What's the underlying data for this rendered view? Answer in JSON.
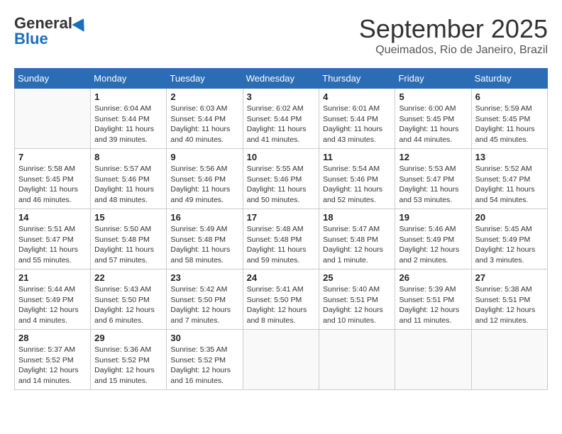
{
  "header": {
    "logo_general": "General",
    "logo_blue": "Blue",
    "month_title": "September 2025",
    "location": "Queimados, Rio de Janeiro, Brazil"
  },
  "columns": [
    "Sunday",
    "Monday",
    "Tuesday",
    "Wednesday",
    "Thursday",
    "Friday",
    "Saturday"
  ],
  "weeks": [
    [
      {
        "day": "",
        "empty": true
      },
      {
        "day": "1",
        "sunrise": "Sunrise: 6:04 AM",
        "sunset": "Sunset: 5:44 PM",
        "daylight": "Daylight: 11 hours and 39 minutes."
      },
      {
        "day": "2",
        "sunrise": "Sunrise: 6:03 AM",
        "sunset": "Sunset: 5:44 PM",
        "daylight": "Daylight: 11 hours and 40 minutes."
      },
      {
        "day": "3",
        "sunrise": "Sunrise: 6:02 AM",
        "sunset": "Sunset: 5:44 PM",
        "daylight": "Daylight: 11 hours and 41 minutes."
      },
      {
        "day": "4",
        "sunrise": "Sunrise: 6:01 AM",
        "sunset": "Sunset: 5:44 PM",
        "daylight": "Daylight: 11 hours and 43 minutes."
      },
      {
        "day": "5",
        "sunrise": "Sunrise: 6:00 AM",
        "sunset": "Sunset: 5:45 PM",
        "daylight": "Daylight: 11 hours and 44 minutes."
      },
      {
        "day": "6",
        "sunrise": "Sunrise: 5:59 AM",
        "sunset": "Sunset: 5:45 PM",
        "daylight": "Daylight: 11 hours and 45 minutes."
      }
    ],
    [
      {
        "day": "7",
        "sunrise": "Sunrise: 5:58 AM",
        "sunset": "Sunset: 5:45 PM",
        "daylight": "Daylight: 11 hours and 46 minutes."
      },
      {
        "day": "8",
        "sunrise": "Sunrise: 5:57 AM",
        "sunset": "Sunset: 5:46 PM",
        "daylight": "Daylight: 11 hours and 48 minutes."
      },
      {
        "day": "9",
        "sunrise": "Sunrise: 5:56 AM",
        "sunset": "Sunset: 5:46 PM",
        "daylight": "Daylight: 11 hours and 49 minutes."
      },
      {
        "day": "10",
        "sunrise": "Sunrise: 5:55 AM",
        "sunset": "Sunset: 5:46 PM",
        "daylight": "Daylight: 11 hours and 50 minutes."
      },
      {
        "day": "11",
        "sunrise": "Sunrise: 5:54 AM",
        "sunset": "Sunset: 5:46 PM",
        "daylight": "Daylight: 11 hours and 52 minutes."
      },
      {
        "day": "12",
        "sunrise": "Sunrise: 5:53 AM",
        "sunset": "Sunset: 5:47 PM",
        "daylight": "Daylight: 11 hours and 53 minutes."
      },
      {
        "day": "13",
        "sunrise": "Sunrise: 5:52 AM",
        "sunset": "Sunset: 5:47 PM",
        "daylight": "Daylight: 11 hours and 54 minutes."
      }
    ],
    [
      {
        "day": "14",
        "sunrise": "Sunrise: 5:51 AM",
        "sunset": "Sunset: 5:47 PM",
        "daylight": "Daylight: 11 hours and 55 minutes."
      },
      {
        "day": "15",
        "sunrise": "Sunrise: 5:50 AM",
        "sunset": "Sunset: 5:48 PM",
        "daylight": "Daylight: 11 hours and 57 minutes."
      },
      {
        "day": "16",
        "sunrise": "Sunrise: 5:49 AM",
        "sunset": "Sunset: 5:48 PM",
        "daylight": "Daylight: 11 hours and 58 minutes."
      },
      {
        "day": "17",
        "sunrise": "Sunrise: 5:48 AM",
        "sunset": "Sunset: 5:48 PM",
        "daylight": "Daylight: 11 hours and 59 minutes."
      },
      {
        "day": "18",
        "sunrise": "Sunrise: 5:47 AM",
        "sunset": "Sunset: 5:48 PM",
        "daylight": "Daylight: 12 hours and 1 minute."
      },
      {
        "day": "19",
        "sunrise": "Sunrise: 5:46 AM",
        "sunset": "Sunset: 5:49 PM",
        "daylight": "Daylight: 12 hours and 2 minutes."
      },
      {
        "day": "20",
        "sunrise": "Sunrise: 5:45 AM",
        "sunset": "Sunset: 5:49 PM",
        "daylight": "Daylight: 12 hours and 3 minutes."
      }
    ],
    [
      {
        "day": "21",
        "sunrise": "Sunrise: 5:44 AM",
        "sunset": "Sunset: 5:49 PM",
        "daylight": "Daylight: 12 hours and 4 minutes."
      },
      {
        "day": "22",
        "sunrise": "Sunrise: 5:43 AM",
        "sunset": "Sunset: 5:50 PM",
        "daylight": "Daylight: 12 hours and 6 minutes."
      },
      {
        "day": "23",
        "sunrise": "Sunrise: 5:42 AM",
        "sunset": "Sunset: 5:50 PM",
        "daylight": "Daylight: 12 hours and 7 minutes."
      },
      {
        "day": "24",
        "sunrise": "Sunrise: 5:41 AM",
        "sunset": "Sunset: 5:50 PM",
        "daylight": "Daylight: 12 hours and 8 minutes."
      },
      {
        "day": "25",
        "sunrise": "Sunrise: 5:40 AM",
        "sunset": "Sunset: 5:51 PM",
        "daylight": "Daylight: 12 hours and 10 minutes."
      },
      {
        "day": "26",
        "sunrise": "Sunrise: 5:39 AM",
        "sunset": "Sunset: 5:51 PM",
        "daylight": "Daylight: 12 hours and 11 minutes."
      },
      {
        "day": "27",
        "sunrise": "Sunrise: 5:38 AM",
        "sunset": "Sunset: 5:51 PM",
        "daylight": "Daylight: 12 hours and 12 minutes."
      }
    ],
    [
      {
        "day": "28",
        "sunrise": "Sunrise: 5:37 AM",
        "sunset": "Sunset: 5:52 PM",
        "daylight": "Daylight: 12 hours and 14 minutes."
      },
      {
        "day": "29",
        "sunrise": "Sunrise: 5:36 AM",
        "sunset": "Sunset: 5:52 PM",
        "daylight": "Daylight: 12 hours and 15 minutes."
      },
      {
        "day": "30",
        "sunrise": "Sunrise: 5:35 AM",
        "sunset": "Sunset: 5:52 PM",
        "daylight": "Daylight: 12 hours and 16 minutes."
      },
      {
        "day": "",
        "empty": true
      },
      {
        "day": "",
        "empty": true
      },
      {
        "day": "",
        "empty": true
      },
      {
        "day": "",
        "empty": true
      }
    ]
  ]
}
